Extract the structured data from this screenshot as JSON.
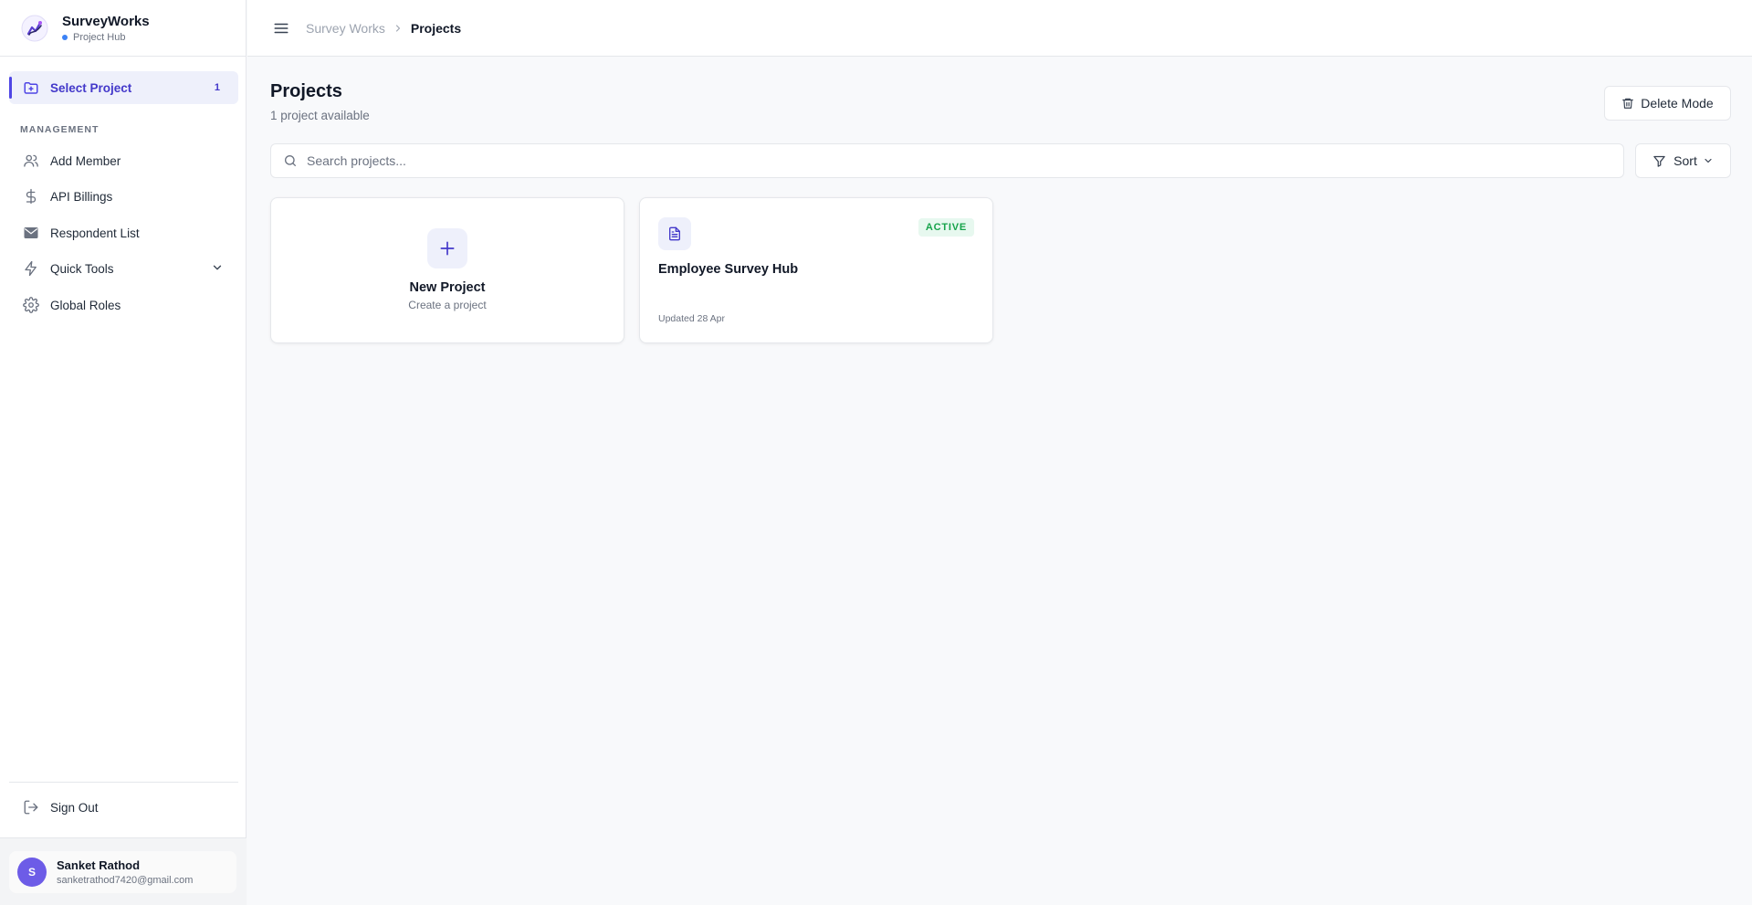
{
  "app": {
    "name": "SurveyWorks",
    "subtitle": "Project Hub"
  },
  "sidebar": {
    "active_item": {
      "label": "Select Project",
      "count": "1",
      "icon": "folder-plus-icon"
    },
    "section_label": "MANAGEMENT",
    "items": [
      {
        "label": "Add Member",
        "icon": "users-icon"
      },
      {
        "label": "API Billings",
        "icon": "dollar-icon"
      },
      {
        "label": "Respondent List",
        "icon": "mail-icon"
      },
      {
        "label": "Quick Tools",
        "icon": "zap-icon"
      },
      {
        "label": "Global Roles",
        "icon": "gear-icon"
      }
    ],
    "sign_out": "Sign Out"
  },
  "user": {
    "initial": "S",
    "name": "Sanket Rathod",
    "email": "sanketrathod7420@gmail.com"
  },
  "breadcrumb": {
    "root": "Survey Works",
    "current": "Projects"
  },
  "main": {
    "title": "Projects",
    "subtitle": "1 project available",
    "delete_mode_label": "Delete Mode",
    "search_placeholder": "Search projects...",
    "sort_label": "Sort",
    "new_project": {
      "title": "New Project",
      "subtitle": "Create a project"
    },
    "projects": [
      {
        "name": "Employee Survey Hub",
        "status": "ACTIVE",
        "updated": "Updated 28 Apr"
      }
    ]
  },
  "colors": {
    "accent": "#4f46e5",
    "active_bg": "#eef0fb",
    "status_active": "#16a34a",
    "avatar": "#6d5ce7"
  }
}
